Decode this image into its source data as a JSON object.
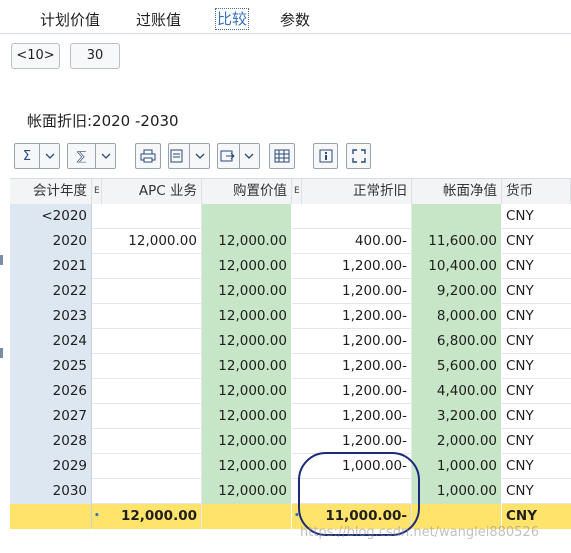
{
  "tabs": [
    "计划价值",
    "过账值",
    "比较",
    "参数"
  ],
  "active_tab": "比较",
  "top_buttons": {
    "prev": "<10>",
    "count": "30"
  },
  "title": "帐面折旧:2020 -2030",
  "toolbar": {
    "sum": "Σ",
    "subtotal": "⅀",
    "icons": [
      "sum-icon",
      "subtotal-icon",
      "print-icon",
      "layout-icon",
      "export-icon",
      "grid-icon",
      "info-icon",
      "fullscreen-icon"
    ]
  },
  "table": {
    "headers": {
      "year": "会计年度",
      "m1": "E",
      "apc": "APC 业务",
      "buy": "购置价值",
      "m2": "E",
      "dep": "正常折旧",
      "book": "帐面净值",
      "cur": "货币"
    },
    "rows": [
      {
        "year": "<2020",
        "apc": "",
        "buy": "",
        "dep": "",
        "book": "",
        "cur": "CNY"
      },
      {
        "year": "2020",
        "apc": "12,000.00",
        "buy": "12,000.00",
        "dep": "400.00-",
        "book": "11,600.00",
        "cur": "CNY"
      },
      {
        "year": "2021",
        "apc": "",
        "buy": "12,000.00",
        "dep": "1,200.00-",
        "book": "10,400.00",
        "cur": "CNY"
      },
      {
        "year": "2022",
        "apc": "",
        "buy": "12,000.00",
        "dep": "1,200.00-",
        "book": "9,200.00",
        "cur": "CNY"
      },
      {
        "year": "2023",
        "apc": "",
        "buy": "12,000.00",
        "dep": "1,200.00-",
        "book": "8,000.00",
        "cur": "CNY"
      },
      {
        "year": "2024",
        "apc": "",
        "buy": "12,000.00",
        "dep": "1,200.00-",
        "book": "6,800.00",
        "cur": "CNY"
      },
      {
        "year": "2025",
        "apc": "",
        "buy": "12,000.00",
        "dep": "1,200.00-",
        "book": "5,600.00",
        "cur": "CNY"
      },
      {
        "year": "2026",
        "apc": "",
        "buy": "12,000.00",
        "dep": "1,200.00-",
        "book": "4,400.00",
        "cur": "CNY"
      },
      {
        "year": "2027",
        "apc": "",
        "buy": "12,000.00",
        "dep": "1,200.00-",
        "book": "3,200.00",
        "cur": "CNY"
      },
      {
        "year": "2028",
        "apc": "",
        "buy": "12,000.00",
        "dep": "1,200.00-",
        "book": "2,000.00",
        "cur": "CNY"
      },
      {
        "year": "2029",
        "apc": "",
        "buy": "12,000.00",
        "dep": "1,000.00-",
        "book": "1,000.00",
        "cur": "CNY"
      },
      {
        "year": "2030",
        "apc": "",
        "buy": "12,000.00",
        "dep": "",
        "book": "1,000.00",
        "cur": "CNY"
      }
    ],
    "total": {
      "marker": "•",
      "apc": "12,000.00",
      "dep": "11,000.00-",
      "cur": "CNY"
    }
  },
  "watermark": "https://blog.csdn.net/wanglei880526"
}
